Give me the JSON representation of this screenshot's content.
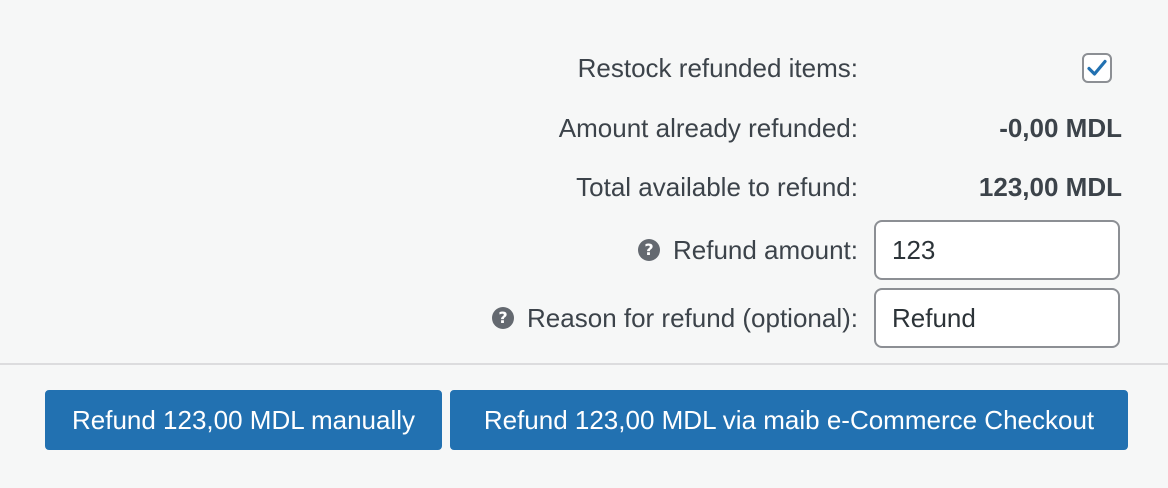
{
  "refund_panel": {
    "restock": {
      "label": "Restock refunded items:",
      "checked": true
    },
    "already_refunded": {
      "label": "Amount already refunded:",
      "value": "-0,00 MDL"
    },
    "total_available": {
      "label": "Total available to refund:",
      "value": "123,00 MDL"
    },
    "refund_amount": {
      "label": "Refund amount:",
      "value": "123",
      "help_icon": "?"
    },
    "reason": {
      "label": "Reason for refund (optional):",
      "value": "Refund",
      "help_icon": "?"
    }
  },
  "actions": {
    "manual_button": "Refund 123,00 MDL manually",
    "gateway_button": "Refund 123,00 MDL via maib e-Commerce Checkout"
  },
  "colors": {
    "background": "#f6f7f7",
    "primary": "#2271b1",
    "checkmark": "#2271b1",
    "text": "#3c434a"
  }
}
